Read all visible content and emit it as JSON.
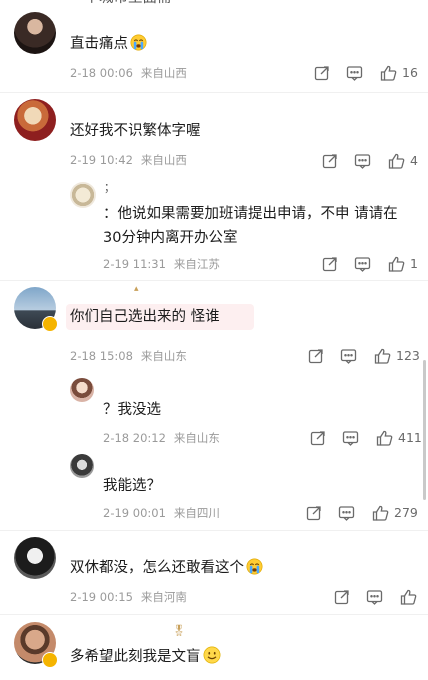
{
  "comments": [
    {
      "text": "直击痛点",
      "date": "2-18 00:06",
      "location": "来自山西",
      "likes": "16",
      "partial_top": "一个城市里面需"
    },
    {
      "text": "还好我不识繁体字喔",
      "date": "2-19 10:42",
      "location": "来自山西",
      "likes": "4",
      "reply": {
        "name_mark": "；",
        "line1": "：他说如果需要加班请提出申请，不申 请请在",
        "line2": "30分钟内离开办公室",
        "date": "2-19 11:31",
        "location": "来自江苏",
        "likes": "1"
      }
    },
    {
      "text": "你们自己选出来的 怪谁",
      "date": "2-18 15:08",
      "location": "来自山东",
      "likes": "123",
      "replies": [
        {
          "text": "？我没选",
          "date": "2-18 20:12",
          "location": "来自山东",
          "likes": "411"
        },
        {
          "text": "我能选？",
          "date": "2-19 00:01",
          "location": "来自四川",
          "likes": "279"
        }
      ]
    },
    {
      "text": "双休都没，怎么还敢看这个",
      "date": "2-19 00:15",
      "location": "来自河南",
      "likes": ""
    },
    {
      "text": "多希望此刻我是文盲",
      "date": "",
      "location": "",
      "likes": ""
    }
  ],
  "icons": {
    "share": "share-icon",
    "comment": "comment-icon",
    "like": "thumbs-up-icon",
    "crying_emoji": "crying-face-emoji",
    "smile_emoji": "smile-face-emoji",
    "verified": "verified-badge-icon"
  },
  "colors": {
    "meta": "#9a9a9a",
    "icon": "#6a6a6a",
    "badge": "#f5b400"
  }
}
